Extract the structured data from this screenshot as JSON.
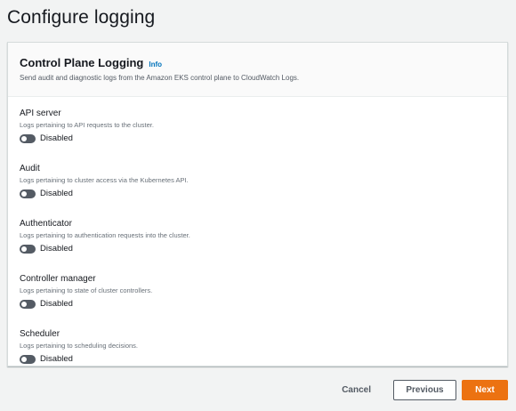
{
  "page": {
    "title": "Configure logging"
  },
  "panel": {
    "title": "Control Plane Logging",
    "info_label": "Info",
    "description": "Send audit and diagnostic logs from the Amazon EKS control plane to CloudWatch Logs."
  },
  "log_types": [
    {
      "label": "API server",
      "description": "Logs pertaining to API requests to the cluster.",
      "status": "Disabled"
    },
    {
      "label": "Audit",
      "description": "Logs pertaining to cluster access via the Kubernetes API.",
      "status": "Disabled"
    },
    {
      "label": "Authenticator",
      "description": "Logs pertaining to authentication requests into the cluster.",
      "status": "Disabled"
    },
    {
      "label": "Controller manager",
      "description": "Logs pertaining to state of cluster controllers.",
      "status": "Disabled"
    },
    {
      "label": "Scheduler",
      "description": "Logs pertaining to scheduling decisions.",
      "status": "Disabled"
    }
  ],
  "footer": {
    "cancel_label": "Cancel",
    "previous_label": "Previous",
    "next_label": "Next"
  },
  "colors": {
    "accent": "#ec7211",
    "link": "#0073bb",
    "toggle_off": "#545b64"
  },
  "icons": {
    "toggle": "toggle-switch-off"
  }
}
